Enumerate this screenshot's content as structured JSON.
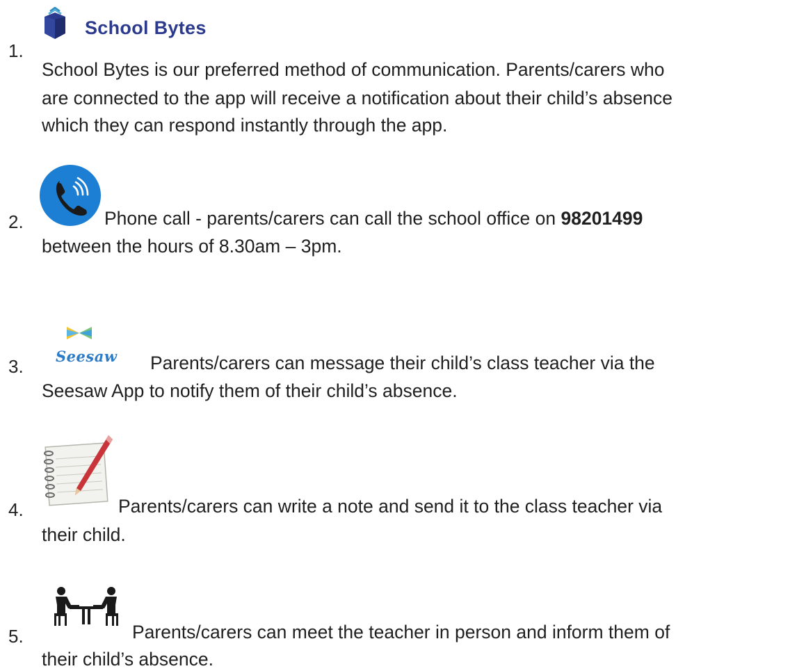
{
  "items": [
    {
      "number": "1.",
      "icon": "school-bytes-logo-icon",
      "brand": "School Bytes",
      "lines": [
        "School Bytes is our preferred method of communication. Parents/carers who",
        "are connected to the app will receive a notification about their child’s absence",
        "which they can respond instantly through the app."
      ]
    },
    {
      "number": "2.",
      "icon": "phone-call-icon",
      "line1_text": "Phone call - parents/carers can call the school office on ",
      "phone": "98201499",
      "line2": "between the hours of 8.30am – 3pm."
    },
    {
      "number": "3.",
      "icon": "seesaw-logo-icon",
      "brand": "Seesaw",
      "line1": "Parents/carers can message their child’s class teacher via the",
      "line2": "Seesaw App to notify them of their child’s absence."
    },
    {
      "number": "4.",
      "icon": "notepad-pencil-icon",
      "line1": "Parents/carers can write a note and send it to the class teacher via",
      "line2": "their child."
    },
    {
      "number": "5.",
      "icon": "meeting-people-icon",
      "line1": "Parents/carers can meet the teacher in person and inform them of",
      "line2": "their child’s absence."
    }
  ],
  "colors": {
    "brand_navy": "#2b3a8c",
    "phone_blue": "#1c7fd4",
    "seesaw_blue": "#2b7bc6",
    "text": "#1f1f1f"
  }
}
